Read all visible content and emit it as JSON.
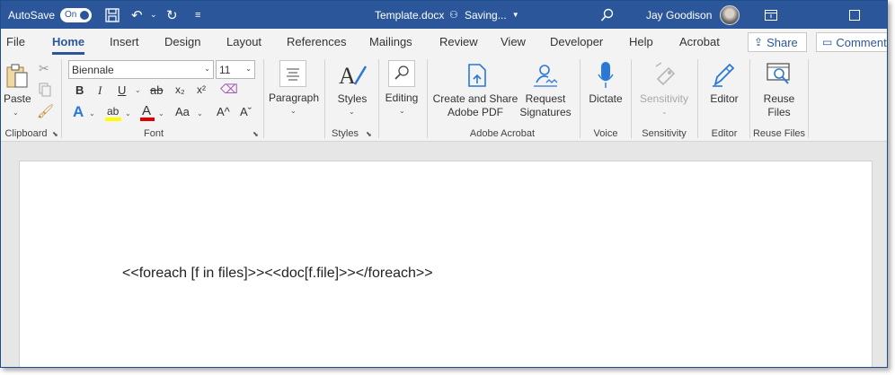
{
  "titlebar": {
    "autosave_label": "AutoSave",
    "autosave_state": "On",
    "filename": "Template.docx",
    "status": "Saving...",
    "user_name": "Jay Goodison"
  },
  "tabs": [
    {
      "label": "File"
    },
    {
      "label": "Home",
      "active": true
    },
    {
      "label": "Insert"
    },
    {
      "label": "Design"
    },
    {
      "label": "Layout"
    },
    {
      "label": "References"
    },
    {
      "label": "Mailings"
    },
    {
      "label": "Review"
    },
    {
      "label": "View"
    },
    {
      "label": "Developer"
    },
    {
      "label": "Help"
    },
    {
      "label": "Acrobat"
    }
  ],
  "share_label": "Share",
  "comments_label": "Comments",
  "ribbon": {
    "clipboard": {
      "paste_label": "Paste",
      "group_label": "Clipboard"
    },
    "font": {
      "font_name": "Biennale",
      "font_size": "11",
      "group_label": "Font",
      "bold": "B",
      "italic": "I",
      "underline": "U",
      "strikethrough": "ab",
      "subscript": "x₂",
      "superscript": "x²",
      "text_effects": "A",
      "highlight": "ab",
      "font_color": "A",
      "change_case": "Aa",
      "grow": "A^",
      "shrink": "Aˇ",
      "highlight_color": "#ffff00",
      "font_color_value": "#e00000"
    },
    "paragraph": {
      "label": "Paragraph"
    },
    "styles": {
      "label": "Styles",
      "group_label": "Styles"
    },
    "editing": {
      "label": "Editing"
    },
    "acrobat": {
      "create_share_line1": "Create and Share",
      "create_share_line2": "Adobe PDF",
      "request_sig_line1": "Request",
      "request_sig_line2": "Signatures",
      "group_label": "Adobe Acrobat"
    },
    "voice": {
      "dictate_label": "Dictate",
      "group_label": "Voice"
    },
    "sensitivity": {
      "label": "Sensitivity",
      "group_label": "Sensitivity"
    },
    "editor": {
      "label": "Editor",
      "group_label": "Editor"
    },
    "reuse": {
      "line1": "Reuse",
      "line2": "Files",
      "group_label": "Reuse Files"
    }
  },
  "document": {
    "text": "<<foreach [f in files]>><<doc[f.file]>></foreach>>"
  },
  "colors": {
    "accent": "#2b579a",
    "ribbon_bg": "#f3f3f3",
    "doc_bg": "#e6e6e6"
  }
}
